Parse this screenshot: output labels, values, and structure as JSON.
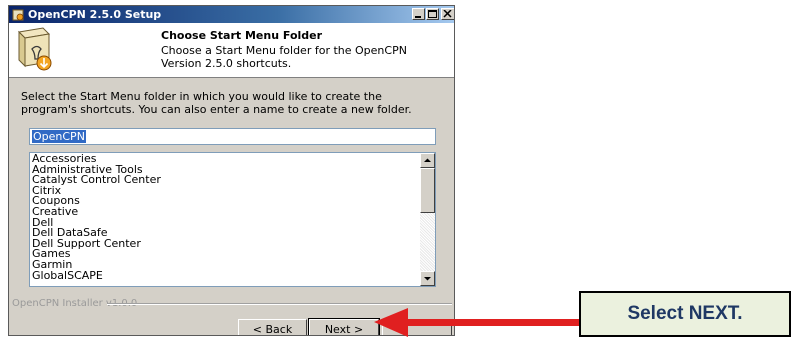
{
  "window": {
    "title": "OpenCPN 2.5.0 Setup"
  },
  "header": {
    "title": "Choose Start Menu Folder",
    "subtitle": "Choose a Start Menu folder for the OpenCPN Version 2.5.0 shortcuts."
  },
  "body": {
    "description": "Select the Start Menu folder in which you would like to create the program's shortcuts. You can also enter a name to create a new folder.",
    "folder_input_value": "OpenCPN",
    "folders": [
      "Accessories",
      "Administrative Tools",
      "Catalyst Control Center",
      "Citrix",
      "Coupons",
      "Creative",
      "Dell",
      "Dell DataSafe",
      "Dell Support Center",
      "Games",
      "Garmin",
      "GlobalSCAPE"
    ]
  },
  "footer": {
    "installer_label": "OpenCPN Installer v1.0.0",
    "back_label": "< Back",
    "next_label": "Next >"
  },
  "callout": {
    "text": "Select NEXT."
  },
  "colors": {
    "title_bar": "#0a246a",
    "arrow": "#e02020",
    "callout_bg": "#ebf1de",
    "callout_text": "#1f3864"
  }
}
